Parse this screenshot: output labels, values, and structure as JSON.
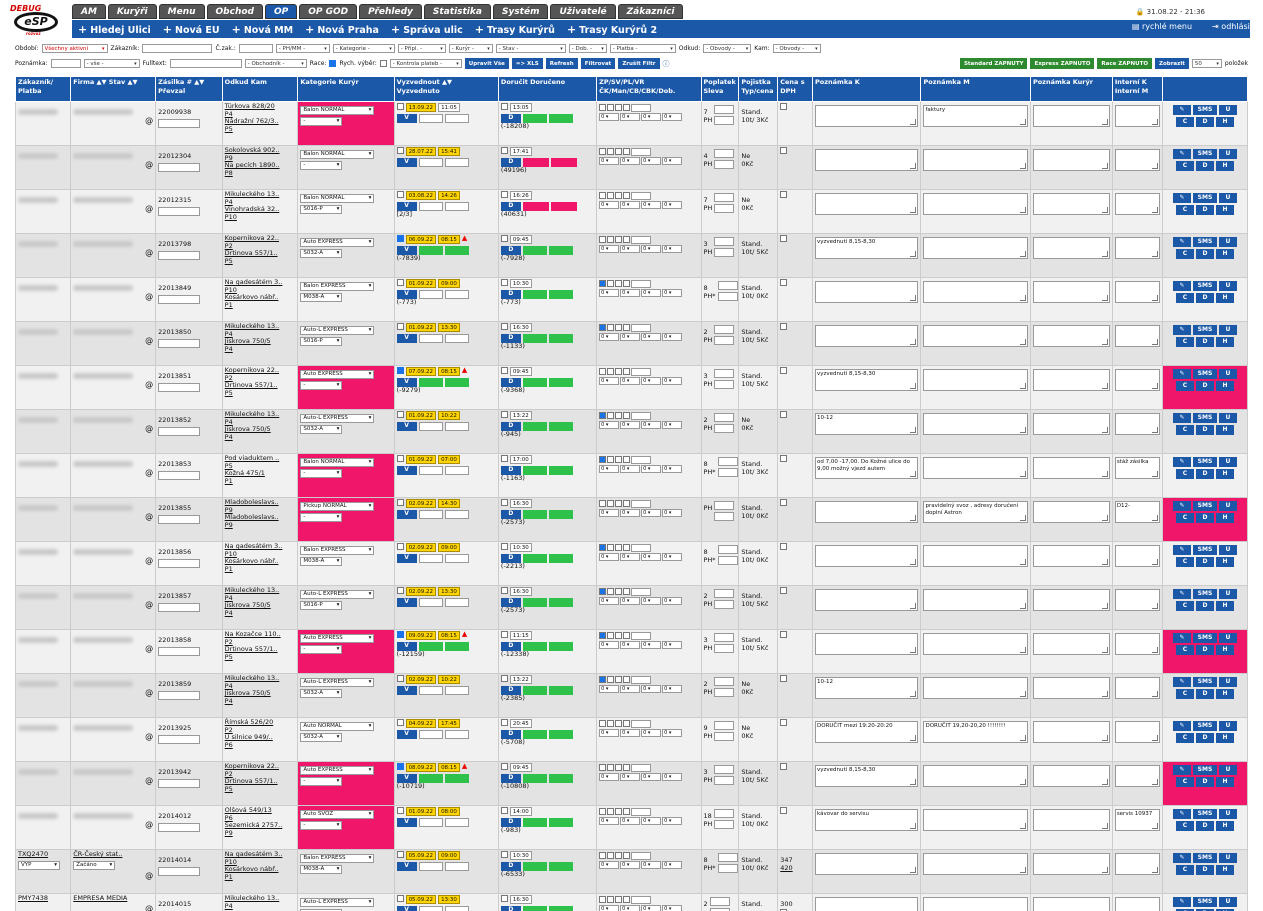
{
  "header": {
    "logo_debug": "DEBUG",
    "logo_mark": "eSP",
    "tabs": [
      {
        "label": "AM"
      },
      {
        "label": "Kurýři"
      },
      {
        "label": "Menu"
      },
      {
        "label": "Obchod"
      },
      {
        "label": "OP"
      },
      {
        "label": "OP GOD"
      },
      {
        "label": "Přehledy"
      },
      {
        "label": "Statistika"
      },
      {
        "label": "Systém"
      },
      {
        "label": "Uživatelé"
      },
      {
        "label": "Zákazníci"
      }
    ],
    "user_time": "🔒 31.08.22 - 21:36",
    "subnav": [
      "Hledej Ulici",
      "Nová EU",
      "Nová MM",
      "Nová Praha",
      "Správa ulic",
      "Trasy Kurýrů",
      "Trasy Kurýrů 2"
    ],
    "quick_menu": "rychlé menu",
    "logout": "odhlásit"
  },
  "filters": {
    "obdobi_label": "Období:",
    "obdobi_value": "Všechny aktivní",
    "zakaznik_label": "Zákazník:",
    "cislo_zak_label": "Č.zak.:",
    "ph_value": "- PH/MM -",
    "kategorie_value": "- Kategorie -",
    "pripl_value": "- Přípl. -",
    "kuryr_value": "- Kurýr -",
    "stav_value": "- Stav -",
    "dob_value": "- Dob. -",
    "platba_value": "- Platba -",
    "odkud_label": "Odkud:",
    "obvody1": "- Obvody -",
    "kam_label": "Kam:",
    "obvody2": "- Obvody -",
    "poznamka_label": "Poznámka:",
    "vse_value": "- vše -",
    "fulltext_label": "Fulltext:",
    "obchodnik_value": "- Obchodník -",
    "race_label": "Race:",
    "rych_label": "Rych. výběr:",
    "kontrola_value": "- Kontrola plateb -",
    "btn_upravit": "Upravit Vše",
    "btn_xls": "=> XLS",
    "btn_refresh": "Refresh",
    "btn_filtrovat": "Filtrovat",
    "btn_zrusit": "Zrušit Filtr",
    "btn_standard": "Standard ZAPNUTY",
    "btn_express": "Express ZAPNUTO",
    "btn_race": "Race ZAPNUTO",
    "btn_zobrazit": "Zobrazit",
    "per_page": "50",
    "per_page_label": "položek"
  },
  "columns": {
    "c1": "Zákazník/ Platba",
    "c2": "Firma ▲▼ Stav ▲▼",
    "c3": "Zásilka # ▲▼ Převzal",
    "c4": "Odkud Kam",
    "c5": "Kategorie Kurýr",
    "c6": "Vyzvednout ▲▼ Vyzvednuto",
    "c7": "Doručit Doručeno",
    "c8": "ZP/SV/PL/VR ČK/Man/CB/CBK/Dob.",
    "c9": "Poplatek Sleva",
    "c10": "Pojistka Typ/cena",
    "c11": "Cena s DPH",
    "c12": "Poznámka K",
    "c13": "Poznámka M",
    "c14": "Poznámka Kurýr",
    "c15": "Interní K Interní M",
    "c16": ""
  },
  "rows": [
    {
      "id": "22009938",
      "from": "Türkova 828/20",
      "fp": "P4",
      "to": "Nádražní 762/3..",
      "tp": "P5",
      "cat": "Balon NORMAL",
      "kur": "-",
      "pink": true,
      "p1": "13.09.22",
      "p2": "11:05",
      "pw": true,
      "warn": false,
      "vnote": "",
      "d1": "13:05",
      "dnote": "(-18208)",
      "dcol": "g",
      "zp": "7",
      "zpu": "PH",
      "poj": "Stand.",
      "poj2": "10t/ 3Kč",
      "pk": "",
      "pm": "faktury",
      "im": "",
      "act": false,
      "chk": false
    },
    {
      "id": "22012304",
      "from": "Sokolovská 902..",
      "fp": "P9",
      "to": "Na pecích 1890..",
      "tp": "P8",
      "cat": "Balon NORMAL",
      "kur": "-",
      "pink": false,
      "p1": "28.07.22",
      "p2": "15:41",
      "pw": false,
      "warn": false,
      "vnote": "",
      "d1": "17:41",
      "dnote": "(49196)",
      "dcol": "p",
      "zp": "4",
      "zpu": "PH",
      "poj": "Ne",
      "poj2": "0Kč",
      "pk": "",
      "pm": "",
      "im": "",
      "act": false,
      "chk": false
    },
    {
      "id": "22012315",
      "from": "Mikuleckého 13..",
      "fp": "P4",
      "to": "Vinohradská 32..",
      "tp": "P10",
      "cat": "Balon NORMAL",
      "kur": "S016-P",
      "pink": false,
      "p1": "03.08.22",
      "p2": "14:26",
      "pw": false,
      "warn": false,
      "vnote": "[2/3]",
      "d1": "16:26",
      "dnote": "(40631)",
      "dcol": "p",
      "zp": "7",
      "zpu": "PH",
      "poj": "Ne",
      "poj2": "0Kč",
      "pk": "",
      "pm": "",
      "im": "",
      "act": false,
      "chk": false
    },
    {
      "id": "22013798",
      "from": "Kopernikova 22..",
      "fp": "P2",
      "to": "Drtinova 557/1..",
      "tp": "P5",
      "cat": "Auto EXPRESS",
      "kur": "S032-A",
      "pink": false,
      "p1": "06.09.22",
      "p2": "08:15",
      "pw": false,
      "warn": true,
      "vnote": "(-7839)",
      "d1": "09:45",
      "dnote": "(-7928)",
      "dcol": "g",
      "zp": "3",
      "zpu": "PH",
      "poj": "Stand.",
      "poj2": "10t/ 5Kč",
      "pk": "vyzvednutí 8,15-8,30",
      "pm": "",
      "im": "",
      "act": false,
      "chk": true
    },
    {
      "id": "22013849",
      "from": "Na gadesátém 3..",
      "fp": "P10",
      "to": "Kosárkovo nábř..",
      "tp": "P1",
      "cat": "Balon EXPRESS",
      "kur": "M038-A",
      "pink": false,
      "p1": "01.09.22",
      "p2": "09:00",
      "pw": false,
      "warn": false,
      "vnote": "(-773)",
      "d1": "10:30",
      "dnote": "(-773)",
      "dcol": "g",
      "zp": "8",
      "zpu": "PH*",
      "poj": "Stand.",
      "poj2": "10t/ 0Kč",
      "pk": "",
      "pm": "",
      "im": "",
      "act": false,
      "chk": false
    },
    {
      "id": "22013850",
      "from": "Mikuleckého 13..",
      "fp": "P4",
      "to": "Jiskrova 750/5",
      "tp": "P4",
      "cat": "Auto-L EXPRESS",
      "kur": "S016-P",
      "pink": false,
      "p1": "01.09.22",
      "p2": "13:30",
      "pw": false,
      "warn": false,
      "vnote": "",
      "d1": "16:30",
      "dnote": "(-1133)",
      "dcol": "g",
      "zp": "2",
      "zpu": "PH",
      "poj": "Stand.",
      "poj2": "10t/ 5Kč",
      "pk": "",
      "pm": "",
      "im": "",
      "act": false,
      "chk": false
    },
    {
      "id": "22013851",
      "from": "Kopernikova 22..",
      "fp": "P2",
      "to": "Drtinova 557/1..",
      "tp": "P5",
      "cat": "Auto EXPRESS",
      "kur": "-",
      "pink": true,
      "p1": "07.09.22",
      "p2": "08:15",
      "pw": false,
      "warn": true,
      "vnote": "(-9279)",
      "d1": "09:45",
      "dnote": "(-9368)",
      "dcol": "g",
      "zp": "3",
      "zpu": "PH",
      "poj": "Stand.",
      "poj2": "10t/ 5Kč",
      "pk": "vyzvednutí 8,15-8,30",
      "pm": "",
      "im": "",
      "act": true,
      "chk": true
    },
    {
      "id": "22013852",
      "from": "Mikuleckého 13..",
      "fp": "P4",
      "to": "Jiskrova 750/5",
      "tp": "P4",
      "cat": "Auto-L EXPRESS",
      "kur": "S032-A",
      "pink": false,
      "p1": "01.09.22",
      "p2": "10:22",
      "pw": false,
      "warn": false,
      "vnote": "",
      "d1": "13:22",
      "dnote": "(-945)",
      "dcol": "g",
      "zp": "2",
      "zpu": "PH",
      "poj": "Ne",
      "poj2": "0Kč",
      "pk": "10-12",
      "pm": "",
      "im": "",
      "act": false,
      "chk": false
    },
    {
      "id": "22013853",
      "from": "Pod viaduktem ..",
      "fp": "P5",
      "to": "Kožná 475/1",
      "tp": "P1",
      "cat": "Balon NORMAL",
      "kur": "-",
      "pink": true,
      "p1": "01.09.22",
      "p2": "07:00",
      "pw": false,
      "warn": false,
      "vnote": "",
      "d1": "17:00",
      "dnote": "(-1163)",
      "dcol": "g",
      "zp": "8",
      "zpu": "PH*",
      "poj": "Stand.",
      "poj2": "10t/ 3Kč",
      "pk": "od 7,00 -17,00. Do Kožné ulice do 9,00 možný vjezd autem",
      "pm": "",
      "im": "stáž zásilka",
      "act": false,
      "chk": false
    },
    {
      "id": "22013855",
      "from": "Mladoboleslavs..",
      "fp": "P9",
      "to": "Mladoboleslavs..",
      "tp": "P9",
      "cat": "Pickup NORMAL",
      "kur": "-",
      "pink": true,
      "p1": "02.09.22",
      "p2": "14:30",
      "pw": false,
      "warn": false,
      "vnote": "",
      "d1": "16:30",
      "dnote": "(-2573)",
      "dcol": "g",
      "zp": "",
      "zpu": "PH",
      "poj": "Stand.",
      "poj2": "10t/ 0Kč",
      "pk": "",
      "pm": "pravidelný svoz , adresy doručení doplní Astron",
      "im": "D12-",
      "act": true,
      "chk": false
    },
    {
      "id": "22013856",
      "from": "Na gadesátém 3..",
      "fp": "P10",
      "to": "Kosárkovo nábř..",
      "tp": "P1",
      "cat": "Balon EXPRESS",
      "kur": "M038-A",
      "pink": false,
      "p1": "02.09.22",
      "p2": "09:00",
      "pw": false,
      "warn": false,
      "vnote": "",
      "d1": "10:30",
      "dnote": "(-2213)",
      "dcol": "g",
      "zp": "8",
      "zpu": "PH*",
      "poj": "Stand.",
      "poj2": "10t/ 0Kč",
      "pk": "",
      "pm": "",
      "im": "",
      "act": false,
      "chk": false
    },
    {
      "id": "22013857",
      "from": "Mikuleckého 13..",
      "fp": "P4",
      "to": "Jiskrova 750/5",
      "tp": "P4",
      "cat": "Auto-L EXPRESS",
      "kur": "S016-P",
      "pink": false,
      "p1": "02.09.22",
      "p2": "13:30",
      "pw": false,
      "warn": false,
      "vnote": "",
      "d1": "16:30",
      "dnote": "(-2573)",
      "dcol": "g",
      "zp": "2",
      "zpu": "PH",
      "poj": "Stand.",
      "poj2": "10t/ 5Kč",
      "pk": "",
      "pm": "",
      "im": "",
      "act": false,
      "chk": false
    },
    {
      "id": "22013858",
      "from": "Na Kozačce 110..",
      "fp": "P2",
      "to": "Drtinova 557/1..",
      "tp": "P5",
      "cat": "Auto EXPRESS",
      "kur": "-",
      "pink": true,
      "p1": "09.09.22",
      "p2": "08:15",
      "pw": false,
      "warn": true,
      "vnote": "(-12159)",
      "d1": "11:15",
      "dnote": "(-12338)",
      "dcol": "g",
      "zp": "3",
      "zpu": "PH",
      "poj": "Stand.",
      "poj2": "10t/ 5Kč",
      "pk": "",
      "pm": "",
      "im": "",
      "act": true,
      "chk": true
    },
    {
      "id": "22013859",
      "from": "Mikuleckého 13..",
      "fp": "P4",
      "to": "Jiskrova 750/5",
      "tp": "P4",
      "cat": "Auto-L EXPRESS",
      "kur": "S032-A",
      "pink": false,
      "p1": "02.09.22",
      "p2": "10:22",
      "pw": false,
      "warn": false,
      "vnote": "",
      "d1": "13:22",
      "dnote": "(-2385)",
      "dcol": "g",
      "zp": "2",
      "zpu": "PH",
      "poj": "Ne",
      "poj2": "0Kč",
      "pk": "10-12",
      "pm": "",
      "im": "",
      "act": false,
      "chk": false
    },
    {
      "id": "22013925",
      "from": "Římská 526/20",
      "fp": "P2",
      "to": "U silnice 949/..",
      "tp": "P6",
      "cat": "Auto NORMAL",
      "kur": "S032-A",
      "pink": false,
      "p1": "04.09.22",
      "p2": "17:45",
      "pw": false,
      "warn": false,
      "vnote": "",
      "d1": "20:45",
      "dnote": "(-5708)",
      "dcol": "g",
      "zp": "9",
      "zpu": "PH",
      "poj": "Ne",
      "poj2": "0Kč",
      "pk": "DORUČIT mezi 19:20-20:20",
      "pm": "DORUČIT 19,20-20,20 !!!!!!!!",
      "im": "",
      "act": false,
      "chk": false
    },
    {
      "id": "22013942",
      "from": "Kopernikova 22..",
      "fp": "P2",
      "to": "Drtinova 557/1..",
      "tp": "P5",
      "cat": "Auto EXPRESS",
      "kur": "-",
      "pink": true,
      "p1": "08.09.22",
      "p2": "08:15",
      "pw": false,
      "warn": true,
      "vnote": "(-10719)",
      "d1": "09:45",
      "dnote": "(-10808)",
      "dcol": "g",
      "zp": "3",
      "zpu": "PH",
      "poj": "Stand.",
      "poj2": "10t/ 5Kč",
      "pk": "vyzvednutí 8,15-8,30",
      "pm": "",
      "im": "",
      "act": true,
      "chk": true
    },
    {
      "id": "22014012",
      "from": "Olšová 549/13",
      "fp": "P6",
      "to": "Sezemická 2757..",
      "tp": "P9",
      "cat": "Auto SVOZ",
      "kur": "-",
      "pink": true,
      "p1": "01.09.22",
      "p2": "08:00",
      "pw": false,
      "warn": false,
      "vnote": "",
      "d1": "14:00",
      "dnote": "(-983)",
      "dcol": "g",
      "zp": "18",
      "zpu": "PH",
      "poj": "Stand.",
      "poj2": "10t/ 0Kč",
      "pk": "kávovar do servisu",
      "pm": "",
      "im": "servis 10937",
      "act": false,
      "chk": false
    },
    {
      "id": "22014014",
      "from": "Na gadesátém 3..",
      "fp": "P10",
      "to": "Kosárkovo nábř..",
      "tp": "P1",
      "cat": "Balon EXPRESS",
      "kur": "M038-A",
      "pink": false,
      "p1": "05.09.22",
      "p2": "09:00",
      "pw": false,
      "warn": false,
      "vnote": "",
      "d1": "10:30",
      "dnote": "(-6533)",
      "dcol": "g",
      "zp": "8",
      "zpu": "PH*",
      "poj": "Stand.",
      "poj2": "10t/ 0Kč",
      "pk": "",
      "pm": "",
      "im": "",
      "act": false,
      "chk": false,
      "cust": "TXQ2470",
      "firma": "ČR-Český stat..",
      "pay": "VYP",
      "stav": "Začáno",
      "cena": "347",
      "cena2": "420"
    },
    {
      "id": "22014015",
      "from": "Mikuleckého 13..",
      "fp": "P4",
      "to": "",
      "tp": "",
      "cat": "Auto-L EXPRESS",
      "kur": "",
      "pink": false,
      "p1": "05.09.22",
      "p2": "13:30",
      "pw": false,
      "warn": false,
      "vnote": "",
      "d1": "16:30",
      "dnote": "",
      "dcol": "g",
      "zp": "2",
      "zpu": "",
      "poj": "Stand.",
      "poj2": "",
      "pk": "",
      "pm": "",
      "im": "",
      "act": false,
      "chk": false,
      "cust": "PMY7438",
      "firma": "EMPRESA MEDIA",
      "cena": "300"
    }
  ],
  "actions": {
    "edit": "✎",
    "sms": "SMS",
    "u": "U",
    "c": "C",
    "d": "D",
    "h": "H",
    "v": "V",
    "dd": "D"
  },
  "colors": {
    "accent": "#1b58a8",
    "pink": "#f0176b",
    "green": "#2ec24a",
    "yellow": "#ffd400"
  }
}
